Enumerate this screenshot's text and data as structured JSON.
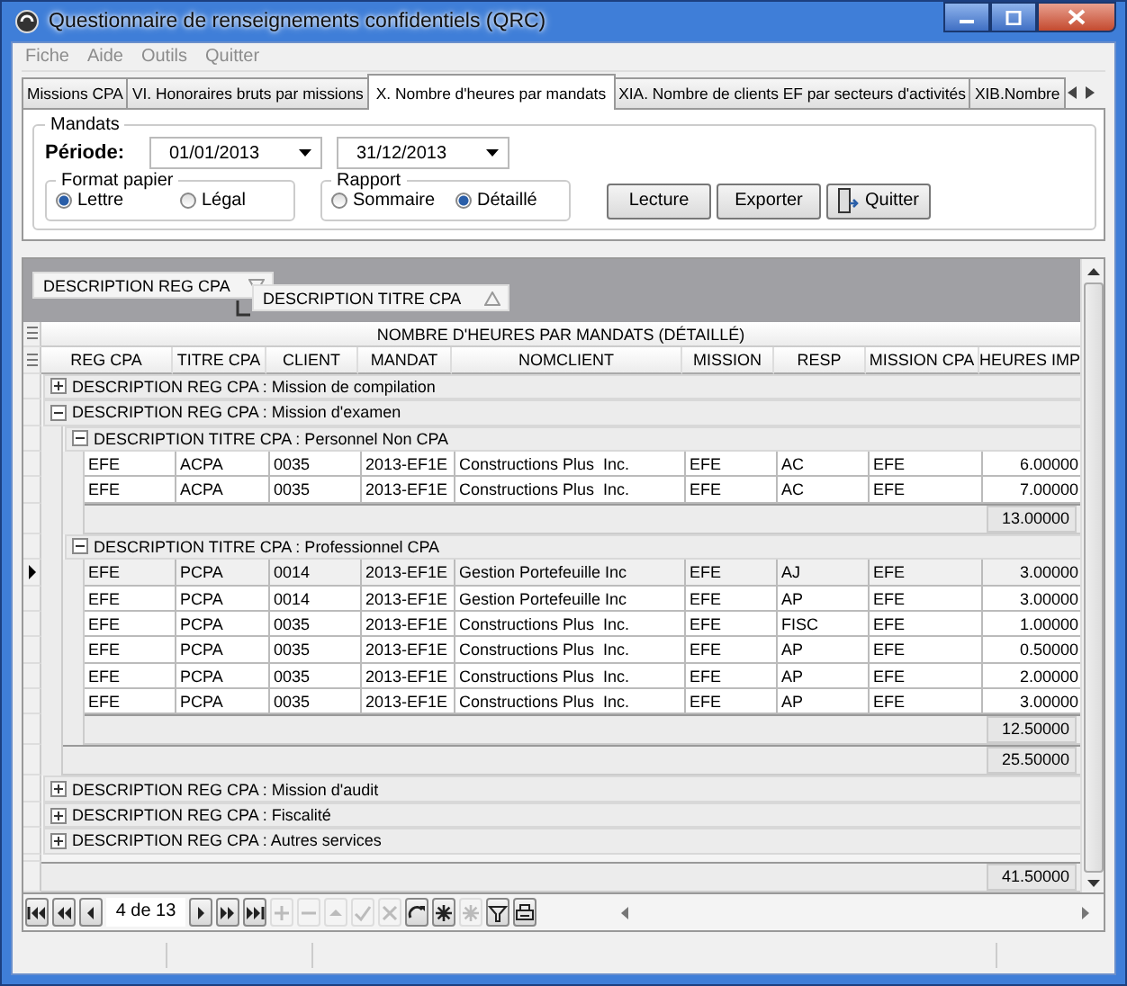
{
  "window": {
    "title": "Questionnaire de renseignements confidentiels (QRC)"
  },
  "menu": [
    {
      "label": "Fiche",
      "disabled": true
    },
    {
      "label": "Aide",
      "disabled": true
    },
    {
      "label": "Outils",
      "disabled": true
    },
    {
      "label": "Quitter",
      "disabled": true
    }
  ],
  "tabs": [
    {
      "label": "Missions CPA",
      "selected": false
    },
    {
      "label": "VI. Honoraires bruts par missions",
      "selected": false
    },
    {
      "label": "X. Nombre d'heures par mandats",
      "selected": true
    },
    {
      "label": "XIA. Nombre de clients EF par secteurs d'activités",
      "selected": false
    },
    {
      "label": "XIB.Nombre",
      "selected": false
    }
  ],
  "mandats": {
    "title": "Mandats",
    "period_label": "Période:",
    "date_from": "01/01/2013",
    "date_to": "31/12/2013",
    "format_papier": {
      "title": "Format papier",
      "options": [
        {
          "label": "Lettre",
          "selected": true
        },
        {
          "label": "Légal",
          "selected": false
        }
      ]
    },
    "rapport": {
      "title": "Rapport",
      "options": [
        {
          "label": "Sommaire",
          "selected": false
        },
        {
          "label": "Détaillé",
          "selected": true
        }
      ]
    },
    "buttons": [
      {
        "label": "Lecture",
        "kind": "text"
      },
      {
        "label": "Exporter",
        "kind": "text"
      },
      {
        "label": "Quitter",
        "kind": "exit"
      }
    ]
  },
  "grid": {
    "group_by": [
      {
        "label": "DESCRIPTION REG CPA",
        "descending": true
      },
      {
        "label": "DESCRIPTION TITRE CPA",
        "descending": false
      }
    ],
    "title": "NOMBRE D'HEURES PAR MANDATS (DÉTAILLÉ)",
    "columns": [
      "REG CPA",
      "TITRE CPA",
      "CLIENT",
      "MANDAT",
      "NOMCLIENT",
      "MISSION",
      "RESP",
      "MISSION CPA",
      "HEURES IMP"
    ],
    "groups": [
      {
        "label": "DESCRIPTION REG CPA : Mission de compilation",
        "expanded": false
      },
      {
        "label": "DESCRIPTION REG CPA : Mission d'examen",
        "expanded": true,
        "total": "25.50000",
        "children": [
          {
            "label": "DESCRIPTION TITRE CPA : Personnel Non CPA",
            "expanded": true,
            "total": "13.00000",
            "rows": [
              {
                "selected": false,
                "cells": [
                  "EFE",
                  "ACPA",
                  "0035",
                  "2013-EF1E",
                  "Constructions Plus  Inc.",
                  "EFE",
                  "AC",
                  "EFE",
                  "6.00000"
                ]
              },
              {
                "selected": false,
                "cells": [
                  "EFE",
                  "ACPA",
                  "0035",
                  "2013-EF1E",
                  "Constructions Plus  Inc.",
                  "EFE",
                  "AC",
                  "EFE",
                  "7.00000"
                ]
              }
            ]
          },
          {
            "label": "DESCRIPTION TITRE CPA : Professionnel CPA",
            "expanded": true,
            "total": "12.50000",
            "rows": [
              {
                "selected": true,
                "cells": [
                  "EFE",
                  "PCPA",
                  "0014",
                  "2013-EF1E",
                  "Gestion Portefeuille Inc",
                  "EFE",
                  "AJ",
                  "EFE",
                  "3.00000"
                ]
              },
              {
                "selected": false,
                "cells": [
                  "EFE",
                  "PCPA",
                  "0014",
                  "2013-EF1E",
                  "Gestion Portefeuille Inc",
                  "EFE",
                  "AP",
                  "EFE",
                  "3.00000"
                ]
              },
              {
                "selected": false,
                "cells": [
                  "EFE",
                  "PCPA",
                  "0035",
                  "2013-EF1E",
                  "Constructions Plus  Inc.",
                  "EFE",
                  "FISC",
                  "EFE",
                  "1.00000"
                ]
              },
              {
                "selected": false,
                "cells": [
                  "EFE",
                  "PCPA",
                  "0035",
                  "2013-EF1E",
                  "Constructions Plus  Inc.",
                  "EFE",
                  "AP",
                  "EFE",
                  "0.50000"
                ]
              },
              {
                "selected": false,
                "cells": [
                  "EFE",
                  "PCPA",
                  "0035",
                  "2013-EF1E",
                  "Constructions Plus  Inc.",
                  "EFE",
                  "AP",
                  "EFE",
                  "2.00000"
                ]
              },
              {
                "selected": false,
                "cells": [
                  "EFE",
                  "PCPA",
                  "0035",
                  "2013-EF1E",
                  "Constructions Plus  Inc.",
                  "EFE",
                  "AP",
                  "EFE",
                  "3.00000"
                ]
              }
            ]
          }
        ]
      },
      {
        "label": "DESCRIPTION REG CPA : Mission d'audit",
        "expanded": false
      },
      {
        "label": "DESCRIPTION REG CPA : Fiscalité",
        "expanded": false
      },
      {
        "label": "DESCRIPTION REG CPA : Autres services",
        "expanded": false
      }
    ],
    "grand_total": "41.50000"
  },
  "navigator": {
    "position": "4 de 13",
    "buttons": [
      {
        "kind": "first",
        "disabled": false
      },
      {
        "kind": "prev-page",
        "disabled": false
      },
      {
        "kind": "prev",
        "disabled": false
      },
      {
        "kind": "position"
      },
      {
        "kind": "next",
        "disabled": false
      },
      {
        "kind": "next-page",
        "disabled": false
      },
      {
        "kind": "last",
        "disabled": false
      },
      {
        "kind": "add",
        "disabled": true
      },
      {
        "kind": "delete",
        "disabled": true
      },
      {
        "kind": "up",
        "disabled": true
      },
      {
        "kind": "apply",
        "disabled": true
      },
      {
        "kind": "cancel",
        "disabled": true
      },
      {
        "kind": "refresh",
        "disabled": false
      },
      {
        "kind": "star",
        "disabled": false
      },
      {
        "kind": "star",
        "disabled": true
      },
      {
        "kind": "filter",
        "disabled": false
      },
      {
        "kind": "print",
        "disabled": false
      }
    ]
  }
}
